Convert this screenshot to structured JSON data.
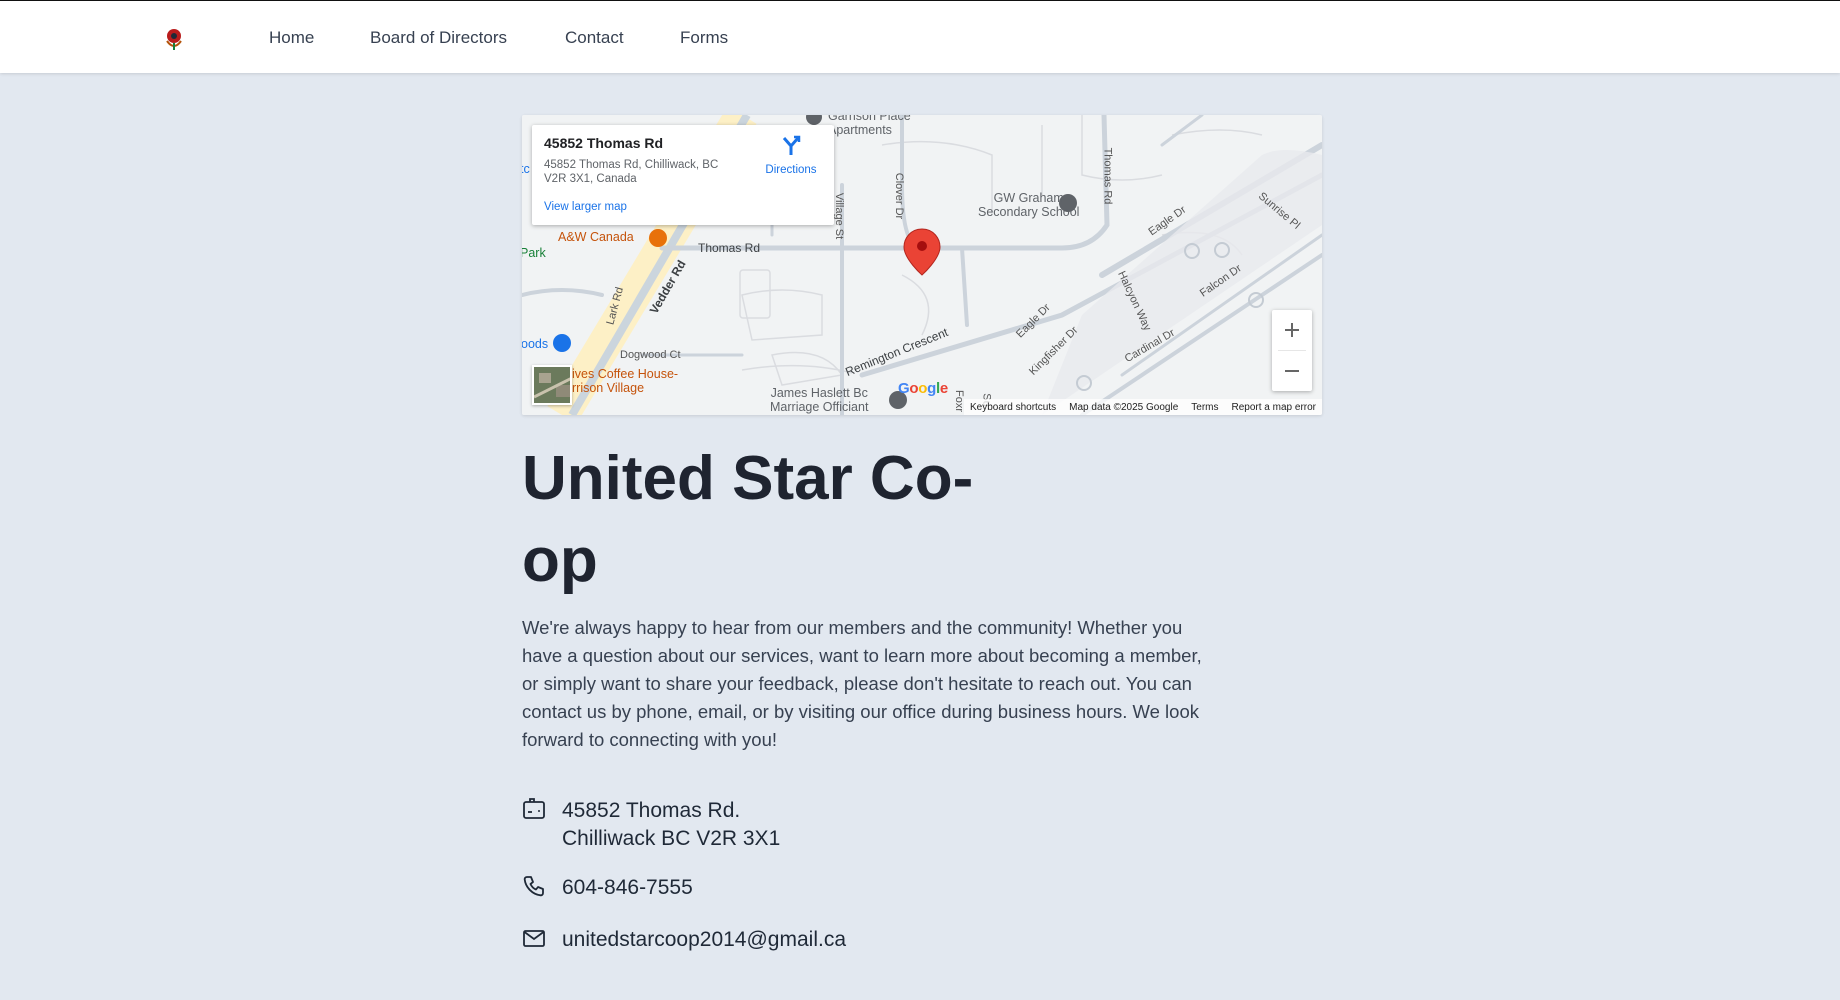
{
  "nav": {
    "logo_icon": "flower-logo-icon",
    "links": [
      "Home",
      "Board of Directors",
      "Contact",
      "Forms"
    ]
  },
  "map": {
    "card": {
      "title": "45852 Thomas Rd",
      "address": "45852 Thomas Rd, Chilliwack, BC V2R 3X1, Canada",
      "directions": "Directions",
      "larger_map": "View larger map"
    },
    "places": {
      "garrison": "Garrison Place\nApartments",
      "aw": "A&W Canada",
      "gw": "GW Graham\nSecondary School",
      "park": "Park",
      "woods": "oods",
      "coffee": "ives Coffee House-\nrrison Village",
      "haslett": "James Haslett Bc\nMarriage Officiant",
      "to": "tc"
    },
    "streets": {
      "thomas": "Thomas Rd",
      "thomas_v": "Thomas Rd",
      "vedder": "Vedder Rd",
      "lark": "Lark Rd",
      "village": "Village St",
      "clover": "Clover Dr",
      "dogwood": "Dogwood Ct",
      "remington": "Remington Crescent",
      "eagle1": "Eagle Dr",
      "eagle2": "Eagle Dr",
      "sunrise": "Sunrise Pl",
      "halcyon": "Halcyon Way",
      "falcon": "Falcon Dr",
      "kingfisher": "Kingfisher Dr",
      "cardinal": "Cardinal Dr",
      "su": "Su",
      "fox": "Foxr"
    },
    "footer": {
      "shortcuts": "Keyboard shortcuts",
      "data": "Map data ©2025 Google",
      "terms": "Terms",
      "report": "Report a map error"
    },
    "google": "Google",
    "zoom_in": "+",
    "zoom_out": "−",
    "colors": {
      "pin": "#ea4335",
      "link": "#1a73e8",
      "food": "#e8710a",
      "school": "#5f6368"
    }
  },
  "page": {
    "title": "United Star Co-op",
    "intro": "We're always happy to hear from our members and the community! Whether you have a question about our services, want to learn more about becoming a member, or simply want to share your feedback, please don't hesitate to reach out. You can contact us by phone, email, or by visiting our office during business hours. We look forward to connecting with you!"
  },
  "contact": {
    "address_line1": "45852 Thomas Rd.",
    "address_line2": "Chilliwack BC V2R 3X1",
    "address_icon": "mailbox-icon",
    "phone": "604-846-7555",
    "phone_icon": "phone-icon",
    "email": "unitedstarcoop2014@gmail.ca",
    "email_icon": "envelope-icon"
  }
}
